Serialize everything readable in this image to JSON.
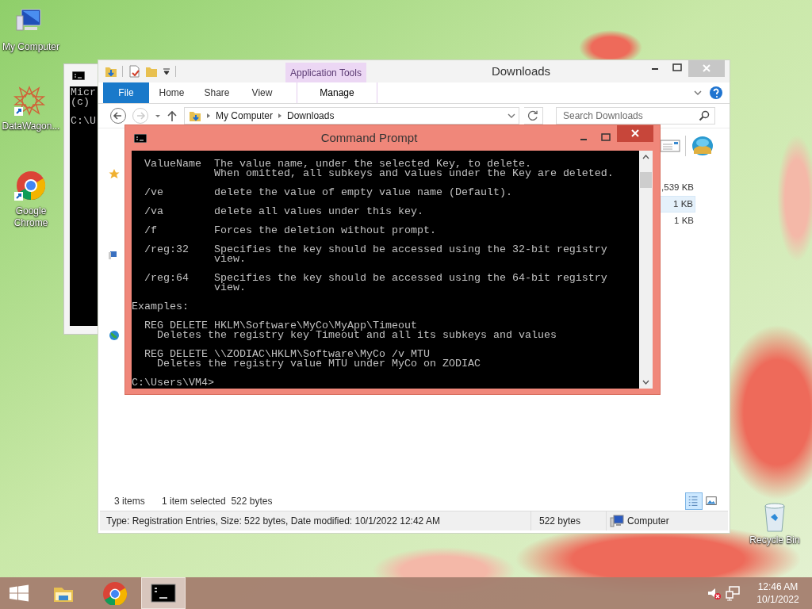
{
  "desktop_icons": [
    {
      "kind": "computer",
      "label": "My Computer"
    },
    {
      "kind": "star",
      "label": "DataWagon..."
    },
    {
      "kind": "chrome",
      "label": "Google Chrome"
    }
  ],
  "recycle_bin": {
    "label": "Recycle Bin"
  },
  "background_console": {
    "lines": [
      "Micr",
      "(c)",
      "C:\\U"
    ]
  },
  "explorer": {
    "title": "Downloads",
    "context_group": "Application Tools",
    "ribbon_tabs": [
      {
        "kind": "file",
        "label": "File"
      },
      {
        "kind": "tab",
        "label": "Home"
      },
      {
        "kind": "tab",
        "label": "Share"
      },
      {
        "kind": "tab",
        "label": "View"
      },
      {
        "kind": "contextual",
        "label": "Manage"
      }
    ],
    "breadcrumb": [
      "My Computer",
      "Downloads"
    ],
    "search": {
      "placeholder": "Search Downloads"
    },
    "rows": [
      {
        "size": ",539 KB",
        "selected": false
      },
      {
        "size": "1 KB",
        "selected": true
      },
      {
        "size": "1 KB",
        "selected": false
      }
    ],
    "item_count": "3 items",
    "selection_info": "1 item selected  522 bytes",
    "view_buttons": [
      {
        "kind": "details",
        "selected": true
      },
      {
        "kind": "thumbnails",
        "selected": false
      }
    ],
    "details_bar": {
      "info": "Type: Registration Entries, Size: 522 bytes, Date modified: 10/1/2022 12:42 AM",
      "size": "522 bytes",
      "location": "Computer"
    }
  },
  "console": {
    "title": "Command Prompt",
    "blocks": [
      [
        "  ValueName  The value name, under the selected Key, to delete.",
        "             When omitted, all subkeys and values under the Key are deleted."
      ],
      [
        "  /ve        delete the value of empty value name (Default)."
      ],
      [
        "  /va        delete all values under this key."
      ],
      [
        "  /f         Forces the deletion without prompt."
      ],
      [
        "  /reg:32    Specifies the key should be accessed using the 32-bit registry",
        "             view."
      ],
      [
        "  /reg:64    Specifies the key should be accessed using the 64-bit registry",
        "             view."
      ],
      [
        "Examples:"
      ],
      [
        "  REG DELETE HKLM\\Software\\MyCo\\MyApp\\Timeout",
        "    Deletes the registry key Timeout and all its subkeys and values"
      ],
      [
        "  REG DELETE \\\\ZODIAC\\HKLM\\Software\\MyCo /v MTU",
        "    Deletes the registry value MTU under MyCo on ZODIAC"
      ]
    ],
    "prompt": "C:\\Users\\VM4>"
  },
  "taskbar": {
    "apps": [
      {
        "kind": "explorer",
        "selected": false
      },
      {
        "kind": "chrome",
        "selected": false
      },
      {
        "kind": "console",
        "selected": true
      }
    ],
    "volume_muted": true,
    "time": "12:46 AM",
    "date": "10/1/2022"
  }
}
